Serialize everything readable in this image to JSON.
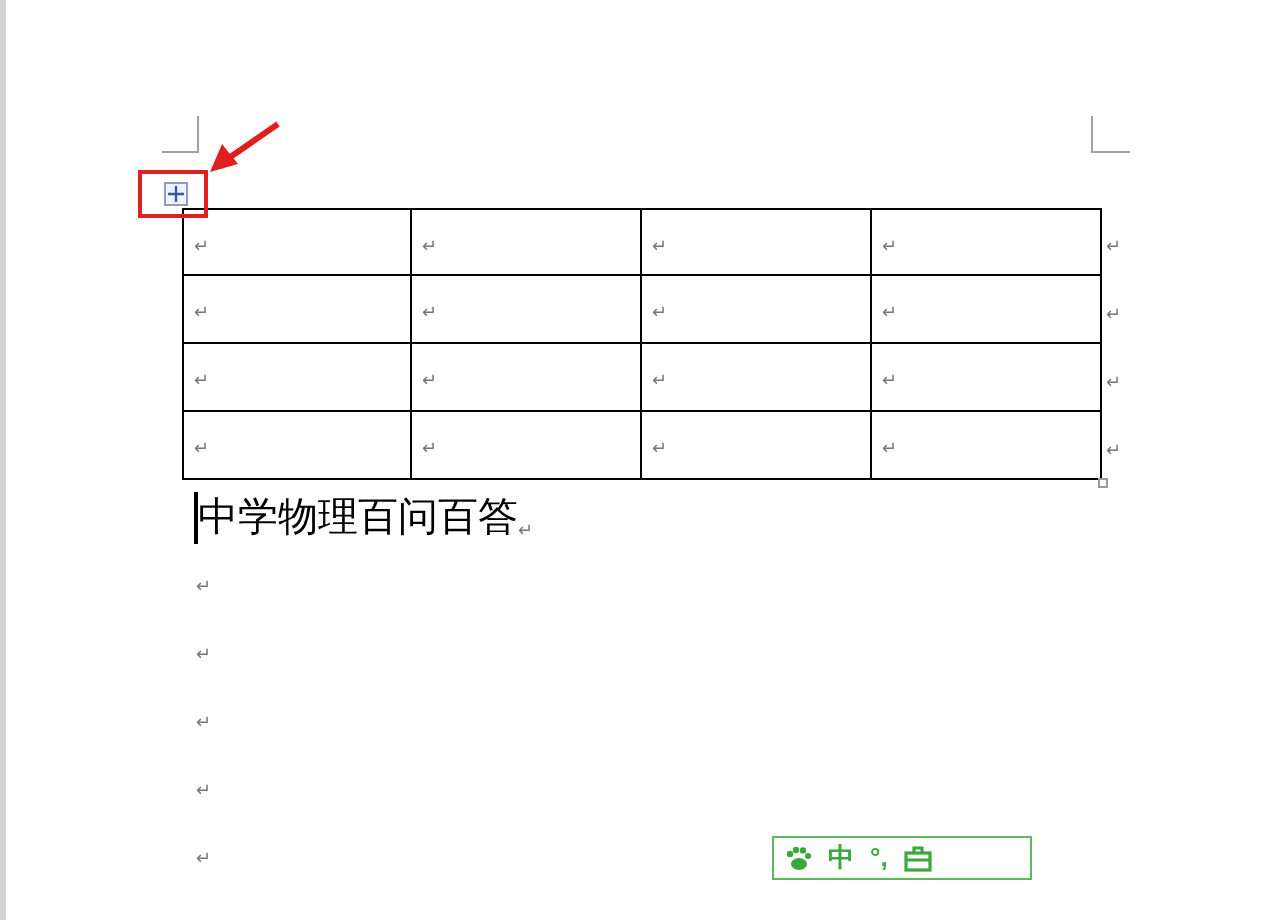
{
  "table": {
    "rows": [
      {
        "cells": [
          "↵",
          "↵",
          "↵",
          "↵"
        ],
        "row_end": "↵"
      },
      {
        "cells": [
          "↵",
          "↵",
          "↵",
          "↵"
        ],
        "row_end": "↵"
      },
      {
        "cells": [
          "↵",
          "↵",
          "↵",
          "↵"
        ],
        "row_end": "↵"
      },
      {
        "cells": [
          "↵",
          "↵",
          "↵",
          "↵"
        ],
        "row_end": "↵"
      }
    ]
  },
  "heading": {
    "text": "中学物理百问百答",
    "mark": "↵"
  },
  "empty_paragraphs": [
    "↵",
    "↵",
    "↵",
    "↵",
    "↵"
  ],
  "ime_toolbar": {
    "mode": "中",
    "punctuation": "°,"
  }
}
